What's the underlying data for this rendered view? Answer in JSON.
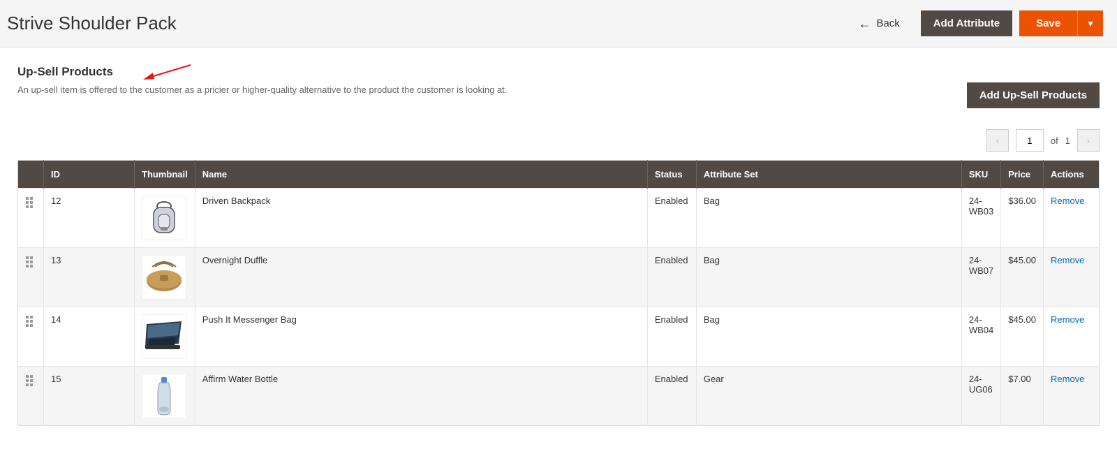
{
  "header": {
    "title": "Strive Shoulder Pack",
    "back_label": "Back",
    "add_attribute_label": "Add Attribute",
    "save_label": "Save"
  },
  "section": {
    "title": "Up-Sell Products",
    "description": "An up-sell item is offered to the customer as a pricier or higher-quality alternative to the product the customer is looking at.",
    "add_button_label": "Add Up-Sell Products"
  },
  "pagination": {
    "current": "1",
    "of_label": "of",
    "total": "1"
  },
  "columns": {
    "id": "ID",
    "thumbnail": "Thumbnail",
    "name": "Name",
    "status": "Status",
    "attribute_set": "Attribute Set",
    "sku": "SKU",
    "price": "Price",
    "actions": "Actions"
  },
  "rows": [
    {
      "id": "12",
      "name": "Driven Backpack",
      "status": "Enabled",
      "attribute_set": "Bag",
      "sku": "24-WB03",
      "price": "$36.00",
      "action": "Remove",
      "thumb": "backpack"
    },
    {
      "id": "13",
      "name": "Overnight Duffle",
      "status": "Enabled",
      "attribute_set": "Bag",
      "sku": "24-WB07",
      "price": "$45.00",
      "action": "Remove",
      "thumb": "duffle"
    },
    {
      "id": "14",
      "name": "Push It Messenger Bag",
      "status": "Enabled",
      "attribute_set": "Bag",
      "sku": "24-WB04",
      "price": "$45.00",
      "action": "Remove",
      "thumb": "messenger"
    },
    {
      "id": "15",
      "name": "Affirm Water Bottle",
      "status": "Enabled",
      "attribute_set": "Gear",
      "sku": "24-UG06",
      "price": "$7.00",
      "action": "Remove",
      "thumb": "bottle"
    }
  ]
}
